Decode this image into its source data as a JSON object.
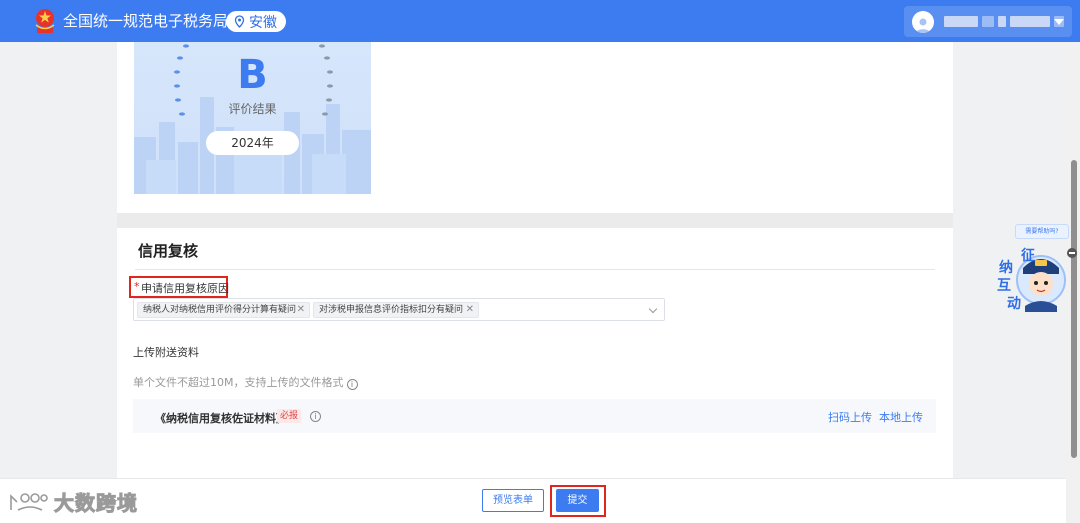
{
  "header": {
    "title": "全国统一规范电子税务局",
    "region": "安徽"
  },
  "credit_card": {
    "grade": "B",
    "grade_label": "评价结果",
    "year": "2024年"
  },
  "review": {
    "section_title": "信用复核",
    "reason_required_mark": "*",
    "reason_label": "申请信用复核原因",
    "reasons": [
      "纳税人对纳税信用评价得分计算有疑问",
      "对涉税申报信息评价指标扣分有疑问"
    ],
    "upload_title": "上传附送资料",
    "upload_hint": "单个文件不超过10M，支持上传的文件格式",
    "file_name": "《纳税信用复核佐证材料》",
    "file_badge": "必报",
    "scan_upload": "扫码上传",
    "local_upload": "本地上传"
  },
  "footer": {
    "preview_label": "预览表单",
    "submit_label": "提交"
  },
  "assistant": {
    "bubble": "需要帮助吗?",
    "chars": [
      "征",
      "纳",
      "互",
      "动"
    ]
  },
  "watermark": {
    "text": "大数跨境"
  },
  "colors": {
    "primary": "#3d7cf0",
    "highlight": "#e0251c"
  }
}
